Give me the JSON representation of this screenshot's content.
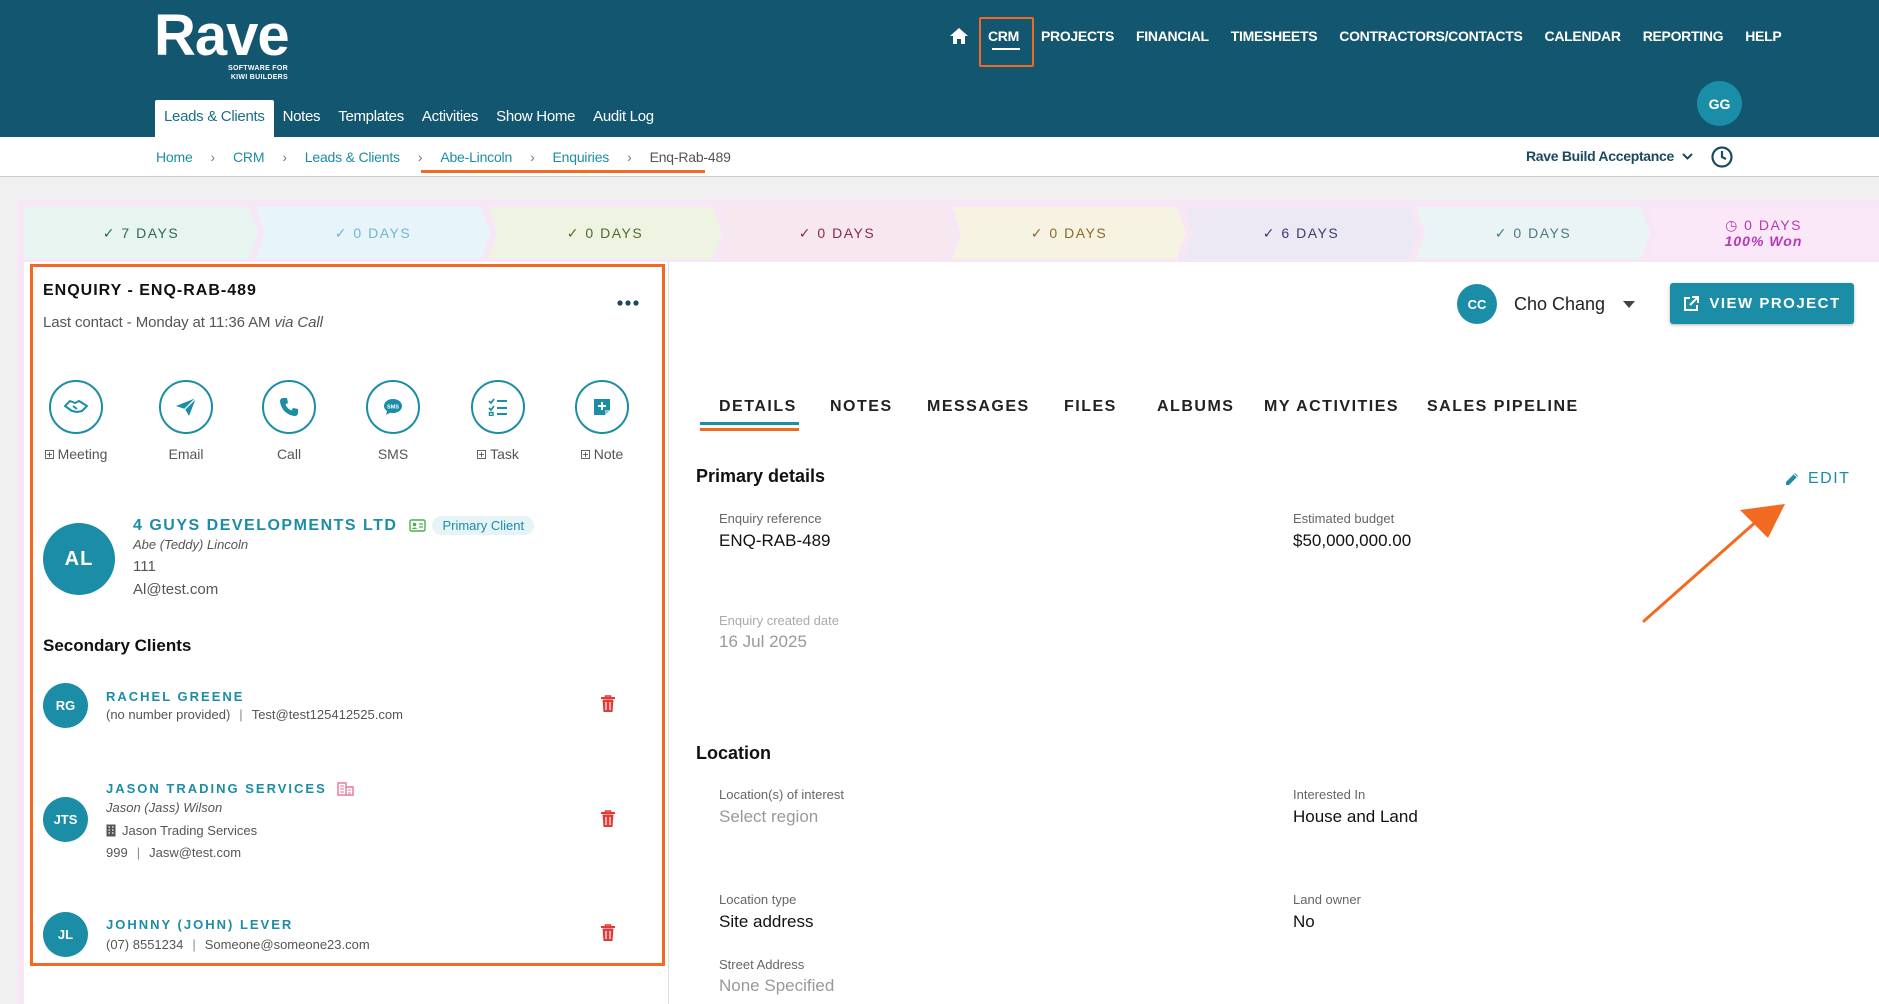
{
  "brand": {
    "name": "Rave",
    "tagline_line1": "SOFTWARE FOR",
    "tagline_line2": "KIWI BUILDERS"
  },
  "main_nav": [
    "CRM",
    "PROJECTS",
    "FINANCIAL",
    "TIMESHEETS",
    "CONTRACTORS/CONTACTS",
    "CALENDAR",
    "REPORTING",
    "HELP"
  ],
  "user": {
    "initials": "GG"
  },
  "sub_nav": [
    "Leads & Clients",
    "Notes",
    "Templates",
    "Activities",
    "Show Home",
    "Audit Log"
  ],
  "breadcrumb": [
    "Home",
    "CRM",
    "Leads & Clients",
    "Abe-Lincoln",
    "Enquiries",
    "Enq-Rab-489"
  ],
  "org": "Rave Build Acceptance",
  "stages": [
    {
      "label": "7 DAYS",
      "bg": "#e8f4ef",
      "color": "#2d6a4f"
    },
    {
      "label": "0 DAYS",
      "bg": "#e7f5fb",
      "color": "#6fb6cf"
    },
    {
      "label": "0 DAYS",
      "bg": "#eef3e2",
      "color": "#4f6d2a"
    },
    {
      "label": "0 DAYS",
      "bg": "#f7e8ef",
      "color": "#8a2a4a"
    },
    {
      "label": "0 DAYS",
      "bg": "#f7f3e3",
      "color": "#8a6a2a"
    },
    {
      "label": "6 DAYS",
      "bg": "#ece8f4",
      "color": "#3f3a74"
    },
    {
      "label": "0 DAYS",
      "bg": "#eaf4f4",
      "color": "#4a7a8a"
    },
    {
      "label": "0 DAYS",
      "sub": "100% Won",
      "bg": "#fae8f9",
      "color": "#b43ab4"
    }
  ],
  "enquiry": {
    "title": "ENQUIRY - ENQ-RAB-489",
    "last_contact": "Last contact - Monday at 11:36 AM",
    "via": "via Call"
  },
  "actions": [
    "Meeting",
    "Email",
    "Call",
    "SMS",
    "Task",
    "Note"
  ],
  "primary_client": {
    "initials": "AL",
    "name": "4 GUYS DEVELOPMENTS LTD",
    "badge": "Primary Client",
    "contact": "Abe (Teddy) Lincoln",
    "phone": "111",
    "email": "Al@test.com"
  },
  "secondary_title": "Secondary Clients",
  "secondary_clients": [
    {
      "initials": "RG",
      "name": "RACHEL GREENE",
      "phone": "(no number provided)",
      "email": "Test@test125412525.com"
    },
    {
      "initials": "JTS",
      "name": "JASON TRADING SERVICES",
      "contact": "Jason (Jass) Wilson",
      "company": "Jason Trading Services",
      "phone": "999",
      "email": "Jasw@test.com"
    },
    {
      "initials": "JL",
      "name": "JOHNNY (JOHN) LEVER",
      "phone": "(07) 8551234",
      "email": "Someone@someone23.com"
    }
  ],
  "owner": {
    "initials": "CC",
    "name": "Cho Chang"
  },
  "view_project": "VIEW PROJECT",
  "tabs": [
    "DETAILS",
    "NOTES",
    "MESSAGES",
    "FILES",
    "ALBUMS",
    "MY ACTIVITIES",
    "SALES PIPELINE"
  ],
  "primary_details": {
    "title": "Primary details",
    "edit": "EDIT",
    "enquiry_reference_label": "Enquiry reference",
    "enquiry_reference": "ENQ-RAB-489",
    "budget_label": "Estimated budget",
    "budget": "$50,000,000.00",
    "created_label": "Enquiry created date",
    "created": "16 Jul 2025"
  },
  "location": {
    "title": "Location",
    "interest_label": "Location(s) of interest",
    "interest": "Select region",
    "interested_in_label": "Interested In",
    "interested_in": "House and Land",
    "type_label": "Location type",
    "type": "Site address",
    "land_owner_label": "Land owner",
    "land_owner": "No",
    "street_label": "Street Address",
    "street": "None Specified"
  },
  "colors": {
    "header": "#13566f",
    "accent": "#1b8da6",
    "highlight": "#f26a21",
    "delete": "#e53935"
  }
}
